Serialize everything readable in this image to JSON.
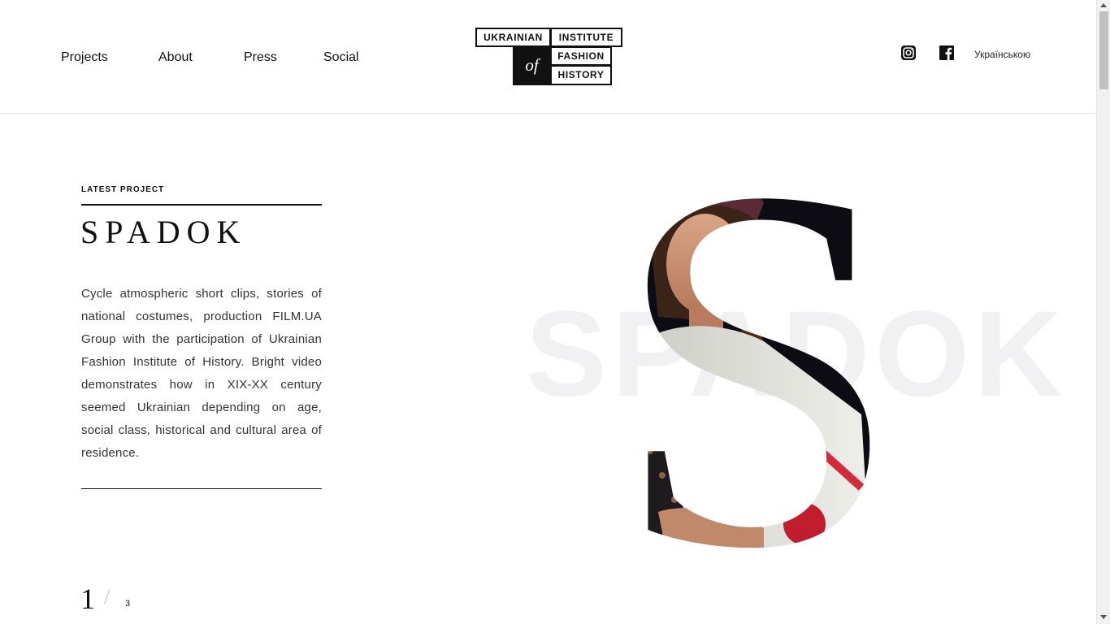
{
  "nav": {
    "items": [
      {
        "label": "Projects"
      },
      {
        "label": "About"
      },
      {
        "label": "Press"
      },
      {
        "label": "Social"
      }
    ]
  },
  "logo": {
    "word1": "UKRAINIAN",
    "word2": "INSTITUTE",
    "of": "of",
    "word3": "FASHION",
    "word4": "HISTORY"
  },
  "social": {
    "instagram_icon": "instagram-icon",
    "facebook_icon": "facebook-icon",
    "language": "Українською"
  },
  "project": {
    "kicker": "LATEST PROJECT",
    "title": "SPADOK",
    "description": "Cycle atmospheric short clips, stories of national costumes, production FILM.UA Group with the participation of Ukrainian Fashion Institute of History. Bright video demonstrates how in XIX-XX century seemed Ukrainian depending on age, social class, historical and cultural area of residence.",
    "background_word": "SPADOK",
    "hero_letter": "S"
  },
  "slider": {
    "current": "1",
    "separator": "/",
    "total": "3"
  },
  "colors": {
    "text": "#111111",
    "header_border": "#e4e4e4",
    "watermark": "#f1f1f3"
  }
}
